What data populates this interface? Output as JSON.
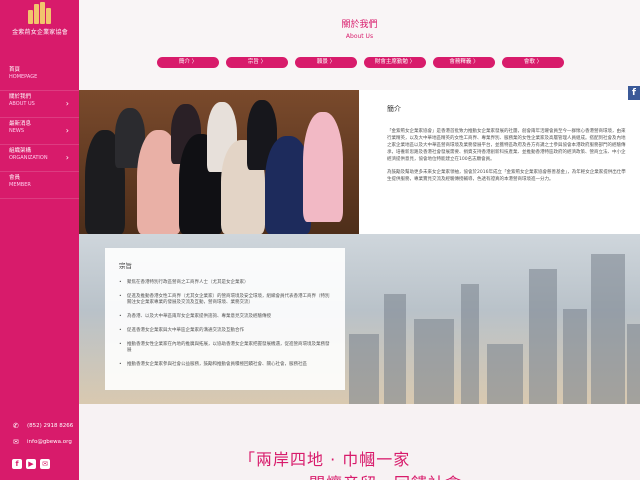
{
  "logo": {
    "text": "金紫荊女企業家協會"
  },
  "sidebar": {
    "items": [
      {
        "zh": "首頁",
        "en": "HOMEPAGE",
        "has_arrow": false
      },
      {
        "zh": "關於我們",
        "en": "ABOUT US",
        "has_arrow": true
      },
      {
        "zh": "最新消息",
        "en": "NEWS",
        "has_arrow": true
      },
      {
        "zh": "組織架構",
        "en": "ORGANIZATION",
        "has_arrow": true
      },
      {
        "zh": "會員",
        "en": "MEMBER",
        "has_arrow": false
      }
    ],
    "phone": "(852) 2918 8266",
    "email": "info@gbewa.org"
  },
  "header": {
    "title_zh": "關於我們",
    "title_en": "About Us",
    "tabs": [
      "簡介 〉",
      "宗旨 〉",
      "願景 〉",
      "財會主席勤勉 〉",
      "會務釋義 〉",
      "會歌 〉"
    ]
  },
  "intro": {
    "heading": "簡介",
    "p1": "「金紫荊女企業家協會」是香港首批致力推動女企業家發展的社團，創會兩年活躍會員至今一群懷心香港營商環境，由來行業精英，以及大中華地區精英的女性工商界、專業界別、服務業的女性企業家及高層管理人員組成。搭配到社會及內地之家企業地區以及大中華區營商環境及業務發展平台，並獲特區政府及各方有識之士參與協會本港政府服務部門的經驗傳承，培養新思路及香港社會發展需要、捐資支持香港創新科技產業、並推動香港特區政府的經濟政策、營商立法、中小企經濟提供意見，協會地位特能建立在100名志願會員。",
    "p2": "為鼓勵及幫助更多未來女企業家領袖，協會於2016年成立「金紫荊女企業家協會慈善基金」，為年輕女企業家提供出仕學生提供服務，專業實見交流及經驗傳授輔導，色透有證真的本港營商環境進一分力。"
  },
  "mission": {
    "heading": "宗旨",
    "items": [
      "聚焦在香港特別行政區營商之工商界人士（尤其是女企業家）",
      "促進及推動香港女性工商界（尤其女企業家）的營商環境及安全環境，組織會員代表香港工商界（特別關注女企業家專業的發展及交流及互動，營商環境、業務交流）",
      "為香港、以及大中華區兩岸女企業家提供諮詢、專業意見交流及經驗傳授",
      "促進香港女企業家與大中華區企業家的溝通交流及互動合作",
      "推動香港女性企業家在內地的推廣與拓展，以協助香港女企業家把握發展機遇，促進營商環境及業務發展",
      "推動香港女企業家參與社會公益服務，鼓勵和推動會員積極回饋社會、關心社會，服務社區"
    ]
  },
  "slogan": {
    "line1": "「兩岸四地 · 巾幗一家",
    "line2": "關懷音留．回饋社會」"
  },
  "social_icons": [
    "f",
    "▶",
    "✉"
  ],
  "floating": {
    "label": "f"
  },
  "colors": {
    "accent": "#d81b6b"
  }
}
